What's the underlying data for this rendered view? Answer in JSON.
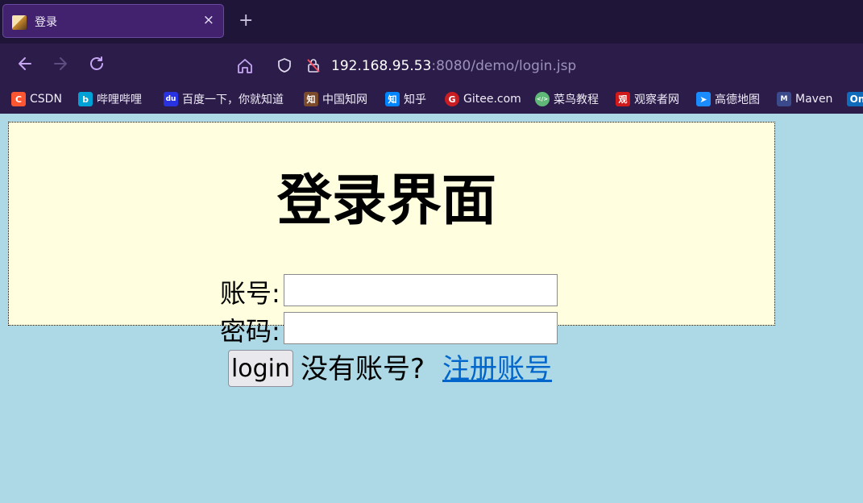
{
  "browser": {
    "tab_title": "登录",
    "tab_close": "×",
    "new_tab": "+",
    "url_host": "192.168.95.53",
    "url_rest": ":8080/demo/login.jsp"
  },
  "bookmarks": [
    {
      "label": "CSDN",
      "icon": "C",
      "color": "#fc5531"
    },
    {
      "label": "哔哩哔哩",
      "icon": "b",
      "color": "#00a1d6"
    },
    {
      "label": "百度一下，你就知道",
      "icon": "du",
      "color": "#2932e1"
    },
    {
      "label": "中国知网",
      "icon": "知",
      "color": "#7a4a2a"
    },
    {
      "label": "知乎",
      "icon": "知",
      "color": "#0084ff"
    },
    {
      "label": "Gitee.com",
      "icon": "G",
      "color": "#c71d23"
    },
    {
      "label": "菜鸟教程",
      "icon": "</>",
      "color": "#5fb878"
    },
    {
      "label": "观察者网",
      "icon": "观",
      "color": "#d0191a"
    },
    {
      "label": "高德地图",
      "icon": "➤",
      "color": "#1a8cff"
    },
    {
      "label": "Maven",
      "icon": "M",
      "color": "#3b4a8a"
    },
    {
      "label": "On",
      "icon": "",
      "color": "#0f6cbd"
    }
  ],
  "page": {
    "heading": "登录界面",
    "account_label": "账号:",
    "account_value": "",
    "password_label": "密码:",
    "password_value": "",
    "login_button": "login",
    "no_account_text": "没有账号?",
    "register_link": "注册账号",
    "colors": {
      "page_background": "#add8e6",
      "box_background": "#ffffe0",
      "link": "#0066cc"
    }
  }
}
